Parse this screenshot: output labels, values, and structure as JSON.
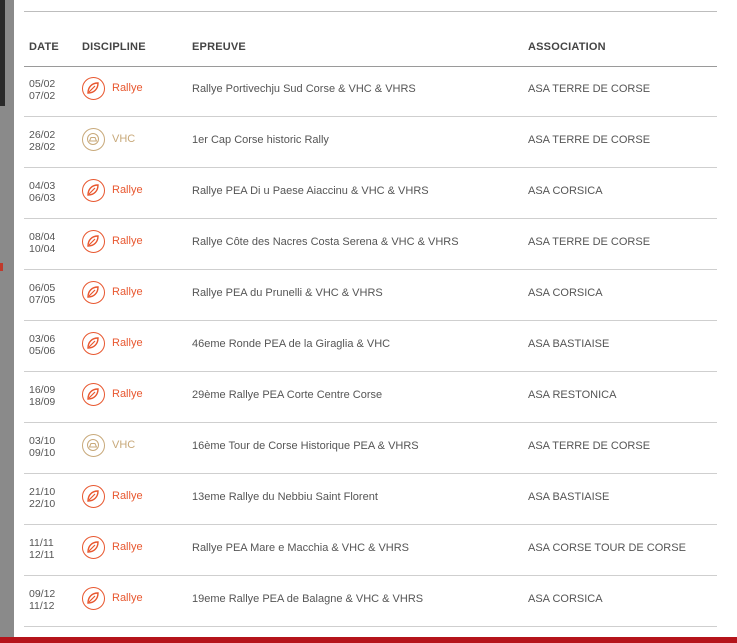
{
  "table": {
    "headers": {
      "date": "DATE",
      "discipline": "DISCIPLINE",
      "event": "EPREUVE",
      "association": "ASSOCIATION"
    },
    "rows": [
      {
        "start": "05/02",
        "end": "07/02",
        "discipline": "Rallye",
        "type": "rallye",
        "event": "Rallye Portivechju Sud Corse & VHC & VHRS",
        "association": "ASA TERRE DE CORSE"
      },
      {
        "start": "26/02",
        "end": "28/02",
        "discipline": "VHC",
        "type": "vhc",
        "event": "1er Cap Corse historic Rally",
        "association": "ASA TERRE DE CORSE"
      },
      {
        "start": "04/03",
        "end": "06/03",
        "discipline": "Rallye",
        "type": "rallye",
        "event": "Rallye PEA Di u Paese Aiaccinu & VHC & VHRS",
        "association": "ASA CORSICA"
      },
      {
        "start": "08/04",
        "end": "10/04",
        "discipline": "Rallye",
        "type": "rallye",
        "event": "Rallye Côte des Nacres Costa Serena & VHC & VHRS",
        "association": "ASA TERRE DE CORSE"
      },
      {
        "start": "06/05",
        "end": "07/05",
        "discipline": "Rallye",
        "type": "rallye",
        "event": "Rallye PEA du Prunelli & VHC & VHRS",
        "association": "ASA CORSICA"
      },
      {
        "start": "03/06",
        "end": "05/06",
        "discipline": "Rallye",
        "type": "rallye",
        "event": "46eme Ronde PEA de la Giraglia & VHC",
        "association": "ASA BASTIAISE"
      },
      {
        "start": "16/09",
        "end": "18/09",
        "discipline": "Rallye",
        "type": "rallye",
        "event": "29ème Rallye PEA Corte Centre Corse",
        "association": "ASA RESTONICA"
      },
      {
        "start": "03/10",
        "end": "09/10",
        "discipline": "VHC",
        "type": "vhc",
        "event": "16ème Tour de Corse Historique PEA & VHRS",
        "association": "ASA TERRE DE CORSE"
      },
      {
        "start": "21/10",
        "end": "22/10",
        "discipline": "Rallye",
        "type": "rallye",
        "event": "13eme Rallye du Nebbiu Saint Florent",
        "association": "ASA BASTIAISE"
      },
      {
        "start": "11/11",
        "end": "12/11",
        "discipline": "Rallye",
        "type": "rallye",
        "event": "Rallye PEA Mare e Macchia & VHC & VHRS",
        "association": "ASA CORSE TOUR DE CORSE"
      },
      {
        "start": "09/12",
        "end": "11/12",
        "discipline": "Rallye",
        "type": "rallye",
        "event": "19eme Rallye PEA de Balagne & VHC & VHRS",
        "association": "ASA CORSICA"
      }
    ]
  },
  "colors": {
    "rallye": "#e8572f",
    "vhc": "#c8a97a",
    "text": "#555555"
  },
  "icons": {
    "rallye": "leaf-badge-icon",
    "vhc": "classic-car-badge-icon"
  }
}
